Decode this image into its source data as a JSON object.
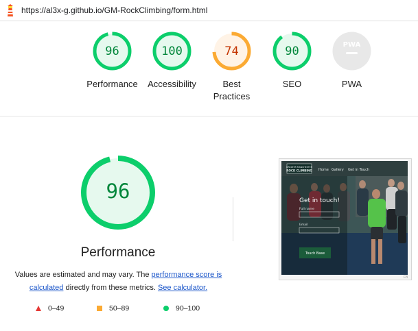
{
  "browser": {
    "url": "https://al3x-g.github.io/GM-RockClimbing/form.html"
  },
  "categories": [
    {
      "label": "Performance",
      "score": 96,
      "color": "#0cce6b",
      "fill": "#e6f9ee",
      "text_color": "#00863a"
    },
    {
      "label": "Accessibility",
      "score": 100,
      "color": "#0cce6b",
      "fill": "#e6f9ee",
      "text_color": "#00863a"
    },
    {
      "label": "Best Practices",
      "score": 74,
      "color": "#fbaa33",
      "fill": "#fff3e6",
      "text_color": "#c33300"
    },
    {
      "label": "SEO",
      "score": 90,
      "color": "#0cce6b",
      "fill": "#e6f9ee",
      "text_color": "#00863a"
    },
    {
      "label": "PWA",
      "badge": "PWA",
      "color": "#c8c8c8",
      "fill": "#e6e6e6"
    }
  ],
  "detail": {
    "score": 96,
    "label": "Performance",
    "desc_prefix": "Values are estimated and may vary. The ",
    "link1": "performance score is calculated",
    "desc_mid": " directly from these metrics. ",
    "link2": "See calculator."
  },
  "legend": [
    {
      "range": "0–49",
      "shape": "triangle",
      "color": "#e53935"
    },
    {
      "range": "50–89",
      "shape": "square",
      "color": "#fbaa33"
    },
    {
      "range": "90–100",
      "shape": "circle",
      "color": "#0cce6b"
    }
  ],
  "screenshot": {
    "logo_line1": "GREATER MANCHESTER",
    "logo_line2": "ROCK CLIMBING",
    "nav": [
      "Home",
      "Gallery",
      "Get in Touch"
    ],
    "heading": "Get in touch!",
    "field1_label": "Full name",
    "field2_label": "Email",
    "button": "Touch Base",
    "footer": "FB"
  }
}
